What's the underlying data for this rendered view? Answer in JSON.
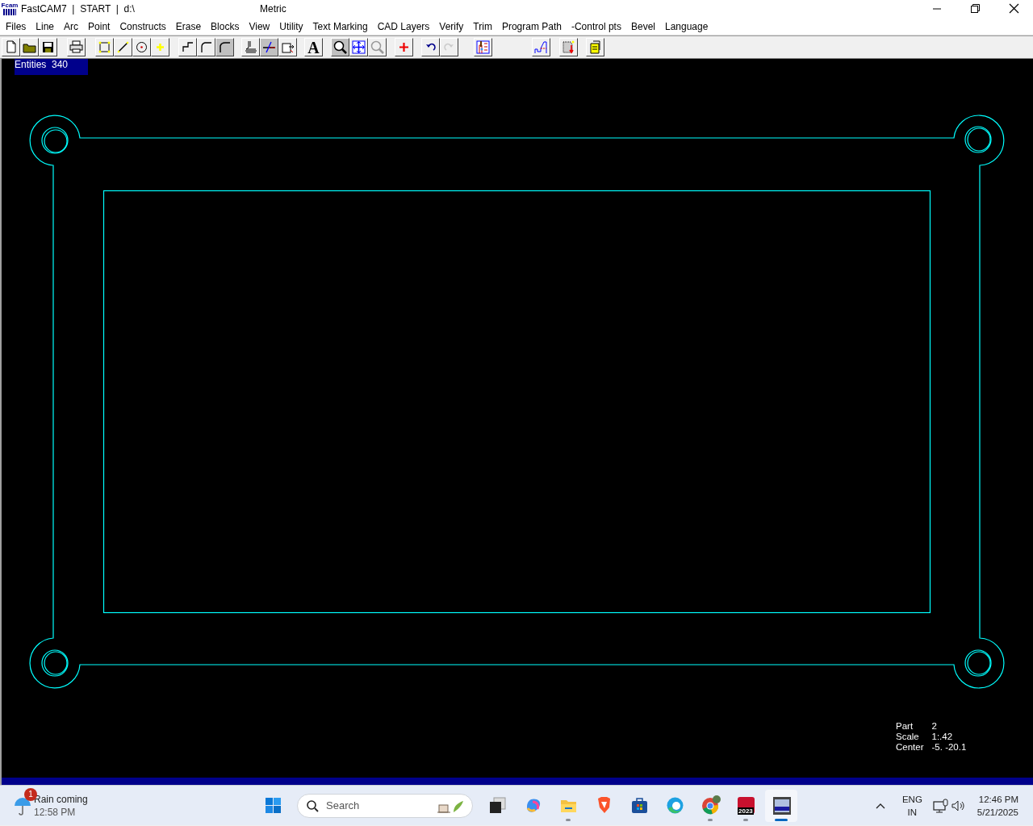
{
  "window": {
    "logo_text": "Fcam",
    "title": "FastCAM7  |  START  |  d:\\",
    "units": "Metric"
  },
  "menu": [
    "Files",
    "Line",
    "Arc",
    "Point",
    "Constructs",
    "Erase",
    "Blocks",
    "View",
    "Utility",
    "Text Marking",
    "CAD Layers",
    "Verify",
    "Trim",
    "Program Path",
    "-Control pts",
    "Bevel",
    "Language"
  ],
  "toolbar": [
    {
      "buttons": [
        {
          "pressed": false
        },
        {
          "pressed": false
        },
        {
          "pressed": false
        }
      ]
    },
    {
      "buttons": [
        {
          "pressed": false
        }
      ]
    },
    {
      "buttons": [
        {
          "pressed": false
        },
        {
          "pressed": false
        },
        {
          "pressed": false
        },
        {
          "pressed": false
        }
      ]
    },
    {
      "buttons": [
        {
          "pressed": false
        },
        {
          "pressed": false
        },
        {
          "pressed": true
        }
      ]
    },
    {
      "buttons": [
        {
          "pressed": false
        },
        {
          "pressed": true
        },
        {
          "pressed": false
        }
      ]
    },
    {
      "buttons": [
        {
          "pressed": false,
          "label": "A"
        }
      ]
    },
    {
      "buttons": [
        {
          "pressed": true
        },
        {
          "pressed": false
        },
        {
          "pressed": false
        }
      ]
    },
    {
      "buttons": [
        {
          "pressed": false
        }
      ]
    },
    {
      "buttons": [
        {
          "pressed": false
        },
        {
          "pressed": false,
          "disabled": true
        }
      ]
    },
    {
      "buttons": [
        {
          "pressed": false
        }
      ]
    },
    {
      "buttons": [
        {
          "pressed": false
        }
      ]
    },
    {
      "buttons": [
        {
          "pressed": false
        }
      ]
    },
    {
      "buttons": [
        {
          "pressed": false
        }
      ]
    }
  ],
  "canvas": {
    "entities": "Entities  340",
    "info": [
      {
        "label": "Part",
        "value": "2"
      },
      {
        "label": "Scale",
        "value": "1:.42"
      },
      {
        "label": "Center",
        "value": "-5. -20.1"
      }
    ]
  },
  "taskbar": {
    "weather": {
      "badge": "1",
      "title": "Rain coming",
      "time": "12:58 PM"
    },
    "search": {
      "placeholder": "Search"
    },
    "apps": [
      {
        "kind": "start",
        "running": false,
        "active": false
      },
      {
        "kind": "taskview",
        "running": false,
        "active": false
      },
      {
        "kind": "copilot",
        "running": false,
        "active": false
      },
      {
        "kind": "explorer",
        "running": true,
        "active": false
      },
      {
        "kind": "browser",
        "running": false,
        "active": false
      },
      {
        "kind": "store",
        "running": false,
        "active": false
      },
      {
        "kind": "edge",
        "running": false,
        "active": false
      },
      {
        "kind": "chrome",
        "running": true,
        "active": false
      },
      {
        "kind": "solidworks",
        "label": "2023",
        "running": true,
        "active": false
      },
      {
        "kind": "fastcam",
        "running": true,
        "active": true
      }
    ],
    "language": [
      "ENG",
      "IN"
    ],
    "clock": {
      "time": "12:46 PM",
      "date": "5/21/2025"
    }
  }
}
